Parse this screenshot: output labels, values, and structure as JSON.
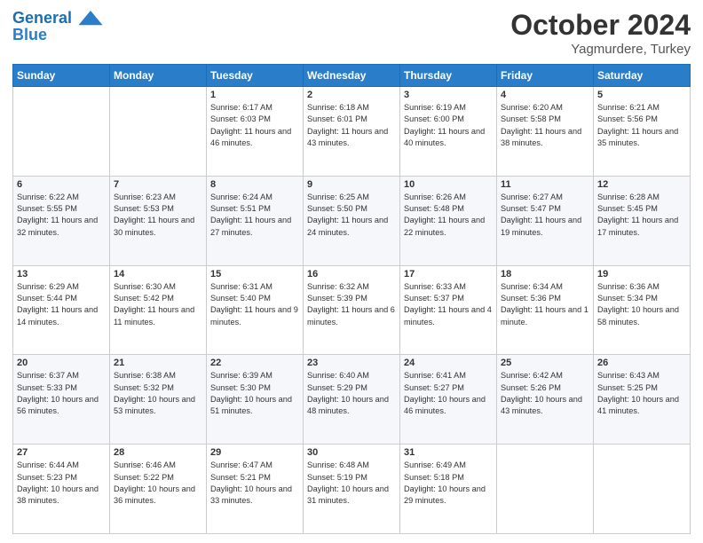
{
  "logo": {
    "line1": "General",
    "line2": "Blue"
  },
  "header": {
    "month": "October 2024",
    "location": "Yagmurdere, Turkey"
  },
  "weekdays": [
    "Sunday",
    "Monday",
    "Tuesday",
    "Wednesday",
    "Thursday",
    "Friday",
    "Saturday"
  ],
  "weeks": [
    [
      {
        "day": "",
        "sunrise": "",
        "sunset": "",
        "daylight": ""
      },
      {
        "day": "",
        "sunrise": "",
        "sunset": "",
        "daylight": ""
      },
      {
        "day": "1",
        "sunrise": "Sunrise: 6:17 AM",
        "sunset": "Sunset: 6:03 PM",
        "daylight": "Daylight: 11 hours and 46 minutes."
      },
      {
        "day": "2",
        "sunrise": "Sunrise: 6:18 AM",
        "sunset": "Sunset: 6:01 PM",
        "daylight": "Daylight: 11 hours and 43 minutes."
      },
      {
        "day": "3",
        "sunrise": "Sunrise: 6:19 AM",
        "sunset": "Sunset: 6:00 PM",
        "daylight": "Daylight: 11 hours and 40 minutes."
      },
      {
        "day": "4",
        "sunrise": "Sunrise: 6:20 AM",
        "sunset": "Sunset: 5:58 PM",
        "daylight": "Daylight: 11 hours and 38 minutes."
      },
      {
        "day": "5",
        "sunrise": "Sunrise: 6:21 AM",
        "sunset": "Sunset: 5:56 PM",
        "daylight": "Daylight: 11 hours and 35 minutes."
      }
    ],
    [
      {
        "day": "6",
        "sunrise": "Sunrise: 6:22 AM",
        "sunset": "Sunset: 5:55 PM",
        "daylight": "Daylight: 11 hours and 32 minutes."
      },
      {
        "day": "7",
        "sunrise": "Sunrise: 6:23 AM",
        "sunset": "Sunset: 5:53 PM",
        "daylight": "Daylight: 11 hours and 30 minutes."
      },
      {
        "day": "8",
        "sunrise": "Sunrise: 6:24 AM",
        "sunset": "Sunset: 5:51 PM",
        "daylight": "Daylight: 11 hours and 27 minutes."
      },
      {
        "day": "9",
        "sunrise": "Sunrise: 6:25 AM",
        "sunset": "Sunset: 5:50 PM",
        "daylight": "Daylight: 11 hours and 24 minutes."
      },
      {
        "day": "10",
        "sunrise": "Sunrise: 6:26 AM",
        "sunset": "Sunset: 5:48 PM",
        "daylight": "Daylight: 11 hours and 22 minutes."
      },
      {
        "day": "11",
        "sunrise": "Sunrise: 6:27 AM",
        "sunset": "Sunset: 5:47 PM",
        "daylight": "Daylight: 11 hours and 19 minutes."
      },
      {
        "day": "12",
        "sunrise": "Sunrise: 6:28 AM",
        "sunset": "Sunset: 5:45 PM",
        "daylight": "Daylight: 11 hours and 17 minutes."
      }
    ],
    [
      {
        "day": "13",
        "sunrise": "Sunrise: 6:29 AM",
        "sunset": "Sunset: 5:44 PM",
        "daylight": "Daylight: 11 hours and 14 minutes."
      },
      {
        "day": "14",
        "sunrise": "Sunrise: 6:30 AM",
        "sunset": "Sunset: 5:42 PM",
        "daylight": "Daylight: 11 hours and 11 minutes."
      },
      {
        "day": "15",
        "sunrise": "Sunrise: 6:31 AM",
        "sunset": "Sunset: 5:40 PM",
        "daylight": "Daylight: 11 hours and 9 minutes."
      },
      {
        "day": "16",
        "sunrise": "Sunrise: 6:32 AM",
        "sunset": "Sunset: 5:39 PM",
        "daylight": "Daylight: 11 hours and 6 minutes."
      },
      {
        "day": "17",
        "sunrise": "Sunrise: 6:33 AM",
        "sunset": "Sunset: 5:37 PM",
        "daylight": "Daylight: 11 hours and 4 minutes."
      },
      {
        "day": "18",
        "sunrise": "Sunrise: 6:34 AM",
        "sunset": "Sunset: 5:36 PM",
        "daylight": "Daylight: 11 hours and 1 minute."
      },
      {
        "day": "19",
        "sunrise": "Sunrise: 6:36 AM",
        "sunset": "Sunset: 5:34 PM",
        "daylight": "Daylight: 10 hours and 58 minutes."
      }
    ],
    [
      {
        "day": "20",
        "sunrise": "Sunrise: 6:37 AM",
        "sunset": "Sunset: 5:33 PM",
        "daylight": "Daylight: 10 hours and 56 minutes."
      },
      {
        "day": "21",
        "sunrise": "Sunrise: 6:38 AM",
        "sunset": "Sunset: 5:32 PM",
        "daylight": "Daylight: 10 hours and 53 minutes."
      },
      {
        "day": "22",
        "sunrise": "Sunrise: 6:39 AM",
        "sunset": "Sunset: 5:30 PM",
        "daylight": "Daylight: 10 hours and 51 minutes."
      },
      {
        "day": "23",
        "sunrise": "Sunrise: 6:40 AM",
        "sunset": "Sunset: 5:29 PM",
        "daylight": "Daylight: 10 hours and 48 minutes."
      },
      {
        "day": "24",
        "sunrise": "Sunrise: 6:41 AM",
        "sunset": "Sunset: 5:27 PM",
        "daylight": "Daylight: 10 hours and 46 minutes."
      },
      {
        "day": "25",
        "sunrise": "Sunrise: 6:42 AM",
        "sunset": "Sunset: 5:26 PM",
        "daylight": "Daylight: 10 hours and 43 minutes."
      },
      {
        "day": "26",
        "sunrise": "Sunrise: 6:43 AM",
        "sunset": "Sunset: 5:25 PM",
        "daylight": "Daylight: 10 hours and 41 minutes."
      }
    ],
    [
      {
        "day": "27",
        "sunrise": "Sunrise: 6:44 AM",
        "sunset": "Sunset: 5:23 PM",
        "daylight": "Daylight: 10 hours and 38 minutes."
      },
      {
        "day": "28",
        "sunrise": "Sunrise: 6:46 AM",
        "sunset": "Sunset: 5:22 PM",
        "daylight": "Daylight: 10 hours and 36 minutes."
      },
      {
        "day": "29",
        "sunrise": "Sunrise: 6:47 AM",
        "sunset": "Sunset: 5:21 PM",
        "daylight": "Daylight: 10 hours and 33 minutes."
      },
      {
        "day": "30",
        "sunrise": "Sunrise: 6:48 AM",
        "sunset": "Sunset: 5:19 PM",
        "daylight": "Daylight: 10 hours and 31 minutes."
      },
      {
        "day": "31",
        "sunrise": "Sunrise: 6:49 AM",
        "sunset": "Sunset: 5:18 PM",
        "daylight": "Daylight: 10 hours and 29 minutes."
      },
      {
        "day": "",
        "sunrise": "",
        "sunset": "",
        "daylight": ""
      },
      {
        "day": "",
        "sunrise": "",
        "sunset": "",
        "daylight": ""
      }
    ]
  ]
}
